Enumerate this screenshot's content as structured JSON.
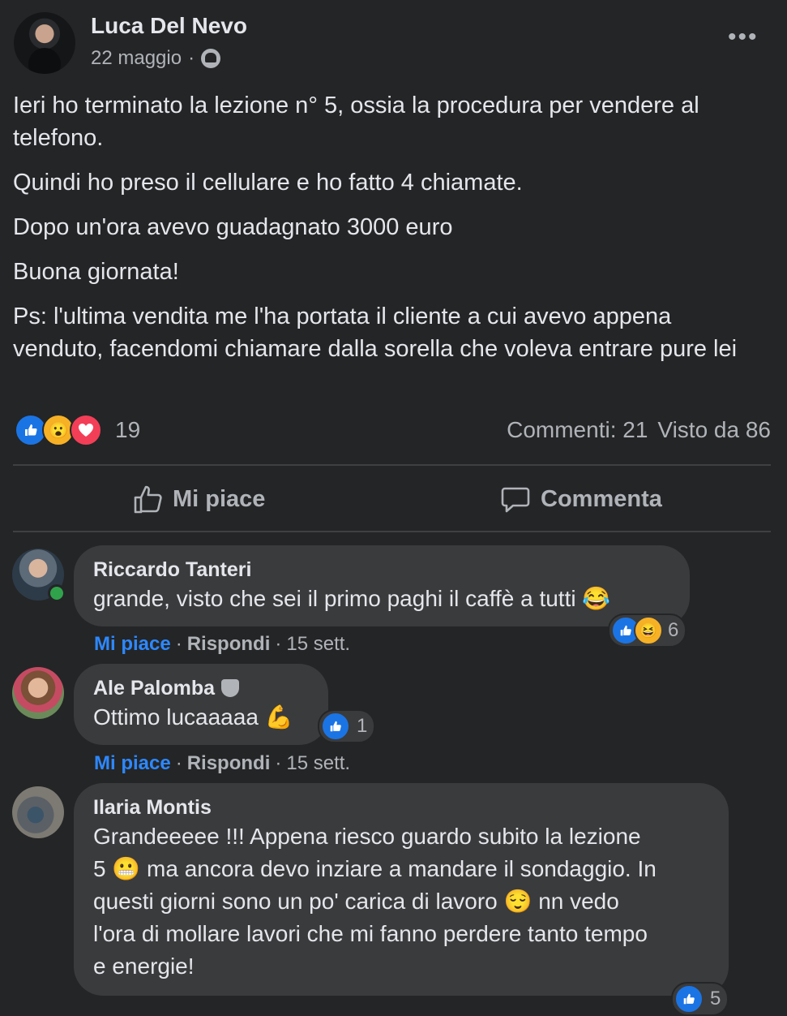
{
  "post": {
    "author": "Luca Del Nevo",
    "date": "22 maggio",
    "separator": "·",
    "more_icon": "more-horizontal-icon",
    "paragraphs": [
      "Ieri ho terminato la lezione n° 5, ossia la procedura per vendere al telefono.",
      "Quindi ho preso il cellulare e ho fatto 4 chiamate.",
      "Dopo un'ora avevo guadagnato 3000 euro",
      "Buona giornata!",
      "Ps: l'ultima vendita me l'ha portata il cliente a cui avevo appena venduto, facendomi chiamare dalla sorella che voleva entrare pure lei"
    ],
    "reaction_count": "19",
    "comments_count": "Commenti: 21",
    "seen_by": "Visto da 86"
  },
  "actions": {
    "like": "Mi piace",
    "comment": "Commenta"
  },
  "comments": [
    {
      "name": "Riccardo Tanteri",
      "text": "grande, visto che sei il primo paghi il caffè a tutti",
      "emoji": "😂",
      "reactions": "6",
      "like_label": "Mi piace",
      "reply_label": "Rispondi",
      "time": "15 sett."
    },
    {
      "name": "Ale Palomba",
      "text": "Ottimo lucaaaaa",
      "emoji": "💪",
      "reactions": "1",
      "like_label": "Mi piace",
      "reply_label": "Rispondi",
      "time": "15 sett."
    },
    {
      "name": "Ilaria Montis",
      "line1": "Grandeeeee !!! Appena riesco guardo subito la lezione",
      "line2a": "5",
      "line2b": "ma ancora devo inziare a mandare il sondaggio. In",
      "line3a": "questi giorni sono un po' carica di lavoro",
      "line3b": "nn vedo",
      "line4": "l'ora di mollare lavori che mi fanno perdere tanto tempo",
      "line5": "e energie!",
      "emoji1": "😬",
      "emoji2": "😌",
      "reactions": "5"
    }
  ],
  "colors": {
    "background": "#242526",
    "bubble": "#3a3b3c",
    "link": "#2d88ff",
    "like": "#1b74e4",
    "love": "#f33e58",
    "online": "#31a24c"
  }
}
